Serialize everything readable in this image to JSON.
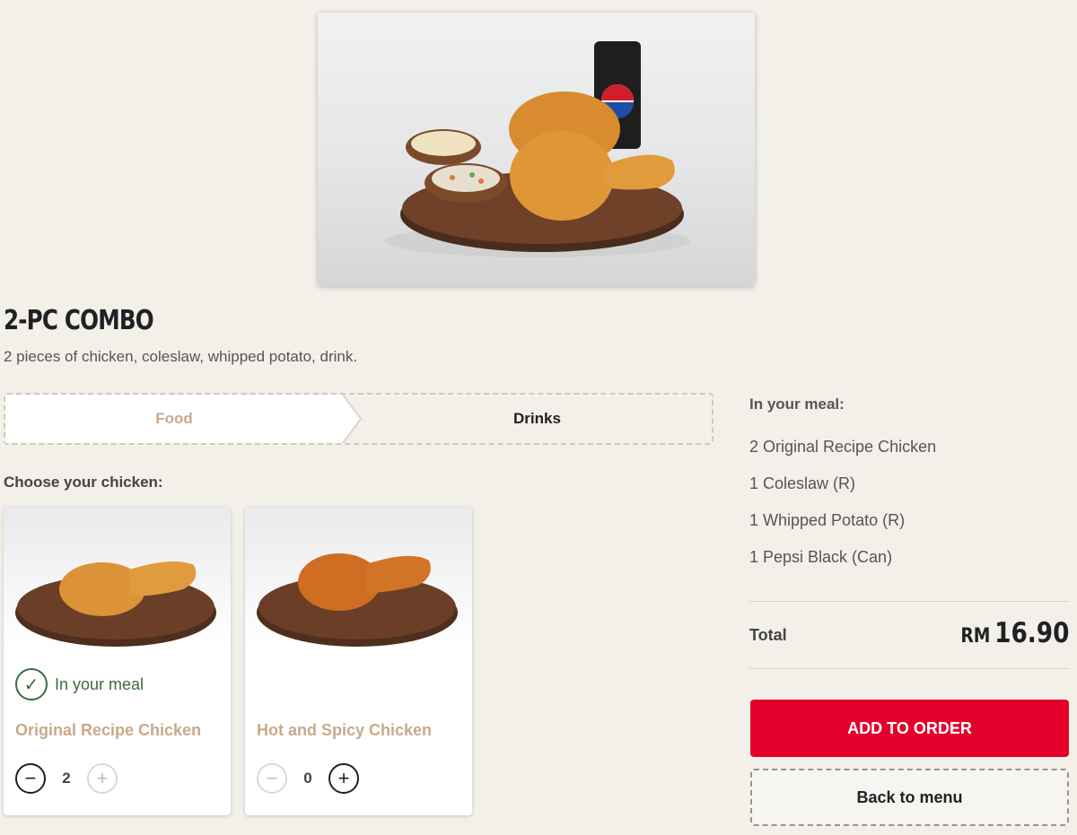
{
  "product": {
    "title": "2-PC COMBO",
    "description": "2 pieces of chicken, coleslaw, whipped potato, drink.",
    "image_alt": "2-PC Combo meal with Pepsi Black can"
  },
  "tabs": [
    {
      "label": "Food",
      "active": true
    },
    {
      "label": "Drinks",
      "active": false
    }
  ],
  "choose_label": "Choose your chicken:",
  "options": [
    {
      "name": "Original Recipe Chicken",
      "quantity": "2",
      "in_meal": true,
      "in_meal_label": "In your meal"
    },
    {
      "name": "Hot and Spicy Chicken",
      "quantity": "0",
      "in_meal": false
    }
  ],
  "summary": {
    "heading": "In your meal:",
    "items": [
      "2 Original Recipe Chicken",
      "1 Coleslaw (R)",
      "1 Whipped Potato (R)",
      "1 Pepsi Black (Can)"
    ],
    "total_label": "Total",
    "currency": "RM",
    "total_amount": "16.90"
  },
  "buttons": {
    "add_to_order": "ADD TO ORDER",
    "back_to_menu": "Back to menu"
  },
  "icons": {
    "check": "check-icon",
    "minus": "minus-icon",
    "plus": "plus-icon"
  },
  "colors": {
    "background": "#f3f0ea",
    "accent_red": "#e4002b",
    "muted_tan": "#c9a98a",
    "success_green": "#3b6b3f"
  }
}
